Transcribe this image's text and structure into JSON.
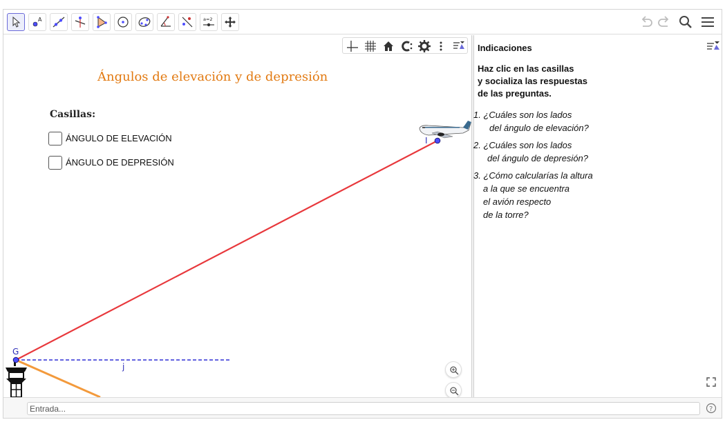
{
  "toolbar": {
    "tools": [
      {
        "name": "move-tool",
        "icon": "arrow-cursor-icon"
      },
      {
        "name": "point-tool",
        "icon": "point-a-icon"
      },
      {
        "name": "line-tool",
        "icon": "line-icon"
      },
      {
        "name": "perpendicular-tool",
        "icon": "perpendicular-icon"
      },
      {
        "name": "polygon-tool",
        "icon": "polygon-icon"
      },
      {
        "name": "circle-tool",
        "icon": "circle-icon"
      },
      {
        "name": "conic-tool",
        "icon": "ellipse-icon"
      },
      {
        "name": "angle-tool",
        "icon": "angle-icon"
      },
      {
        "name": "reflect-tool",
        "icon": "reflect-icon"
      },
      {
        "name": "slider-tool",
        "icon": "slider-icon",
        "label": "a=2"
      },
      {
        "name": "move-graphics-tool",
        "icon": "move-arrows-icon"
      }
    ]
  },
  "graphics": {
    "title": "Ángulos de elevación y de depresión",
    "casillas_label": "Casillas:",
    "checkboxes": [
      {
        "label": "ÁNGULO DE ELEVACIÓN",
        "checked": false
      },
      {
        "label": "ÁNGULO DE DEPRESIÓN",
        "checked": false
      }
    ],
    "points": {
      "g": "G",
      "i": "I",
      "j": "j"
    },
    "colors": {
      "title": "#e27a12",
      "red_line": "#e8383c",
      "orange_line": "#f39a3c",
      "blue_dashed": "#2d2dd6",
      "point": "#4d4dff"
    }
  },
  "side": {
    "heading": "Indicaciones",
    "intro": [
      "Haz clic en las casillas",
      "y socializa las respuestas",
      "de las preguntas."
    ],
    "questions": [
      {
        "lines": [
          "1. ¿Cuáles son los lados",
          "del ángulo de elevación?"
        ]
      },
      {
        "lines": [
          "2. ¿Cuáles son los lados",
          "del ángulo de depresión?"
        ]
      },
      {
        "lines": [
          "3. ¿Cómo calcularías la altura",
          "a la que se encuentra",
          "el avión respecto",
          "de la torre?"
        ]
      }
    ]
  },
  "input": {
    "placeholder": "Entrada..."
  }
}
